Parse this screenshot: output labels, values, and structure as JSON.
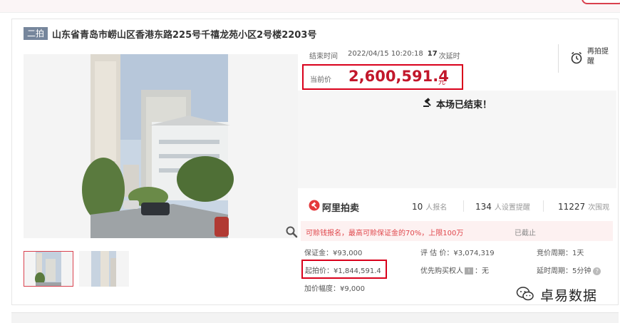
{
  "auction": {
    "round_badge": "二拍",
    "title": "山东省青岛市崂山区香港东路225号千禧龙苑小区2号楼2203号"
  },
  "timing": {
    "end_label": "结束时间",
    "end_time": "2022/04/15 10:20:18",
    "delay_count": "17",
    "delay_label": "次延时"
  },
  "remind": {
    "label": "再拍提醒"
  },
  "price": {
    "label": "当前价",
    "value": "2,600,591.4",
    "unit": "元"
  },
  "status": {
    "text": "本场已结束！"
  },
  "brand": {
    "name": "阿里拍卖"
  },
  "stats": {
    "signups": "10",
    "signups_label": "人报名",
    "reminders": "134",
    "reminders_label": "人设置提醒",
    "views": "11227",
    "views_label": "次围观"
  },
  "deposit": {
    "note": "可赊钱报名，最高可赊保证金的70%，上限100万",
    "status": "已截止"
  },
  "details": {
    "deposit": "保证金：¥93,000",
    "appraisal": "评 估 价：¥3,074,319",
    "bid_cycle": "竞价周期：1天",
    "start_price": "起拍价：¥1,844,591.4",
    "priority_label": "优先购买权人",
    "priority_value": "：无",
    "delay_cycle": "延时周期：5分钟",
    "increment": "加价幅度：¥9,000"
  },
  "watermark": {
    "text": "卓易数据"
  },
  "icons": {
    "zoom": "magnifier-icon",
    "remind": "alarm-clock-icon",
    "status": "gavel-icon",
    "brand": "ali-auction-logo-icon",
    "help": "question-icon",
    "wechat": "wechat-icon"
  },
  "colors": {
    "accent_red": "#c2172b",
    "highlight_border": "#d9001b",
    "badge_bg": "#76869c"
  }
}
